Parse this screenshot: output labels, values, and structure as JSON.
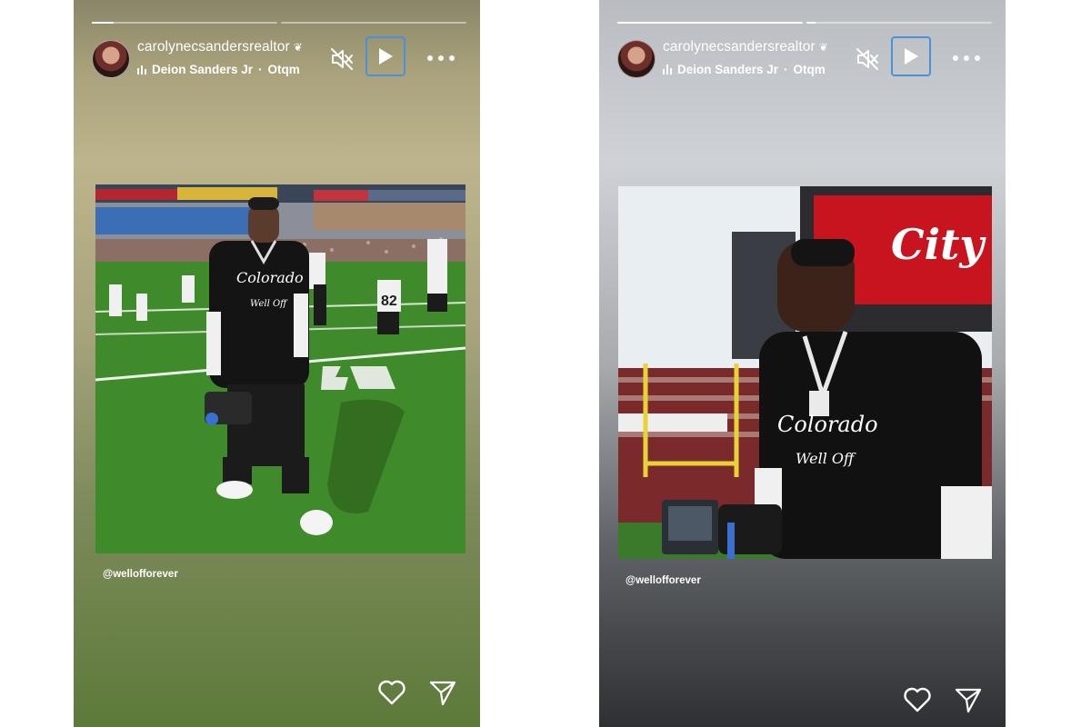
{
  "stories": [
    {
      "username": "carolynecsanders​realtor",
      "verified_icon": "laurel-icon",
      "music_artist": "Deion Sanders Jr",
      "time_ago": "Otqm",
      "progress": [
        0.12,
        0
      ],
      "jersey_number": "82",
      "shirt_line1": "Colorado",
      "shirt_line2": "Well Off",
      "caption": "@wellofforever"
    },
    {
      "username": "carolynecsanders​realtor",
      "verified_icon": "laurel-icon",
      "music_artist": "Deion Sanders Jr",
      "time_ago": "Otqm",
      "progress": [
        1.0,
        0.05
      ],
      "stadium_sign": "City",
      "shirt_line1": "Colorado",
      "shirt_line2": "Well Off",
      "caption": "@wellofforever"
    }
  ],
  "colors": {
    "focus_ring": "#4f8fd6",
    "icon": "#ffffff",
    "field_green": "#3f8a2a",
    "stadium_red": "#c8141e"
  }
}
